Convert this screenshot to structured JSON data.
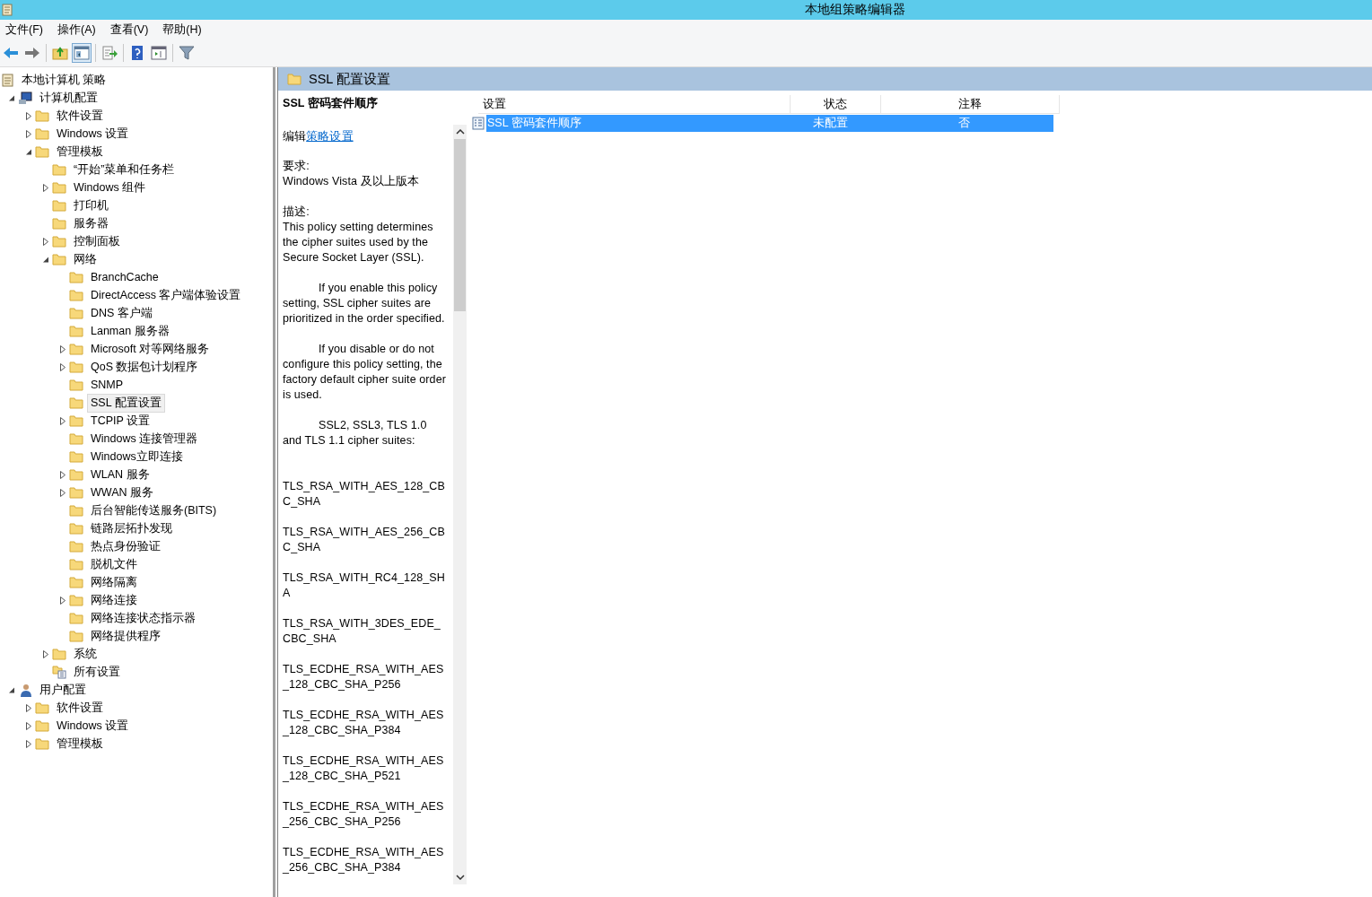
{
  "window": {
    "title": "本地组策略编辑器"
  },
  "menu": [
    "文件(F)",
    "操作(A)",
    "查看(V)",
    "帮助(H)"
  ],
  "toolbar": [
    {
      "kind": "back",
      "pressed": false
    },
    {
      "kind": "forward",
      "pressed": false
    },
    {
      "kind": "up",
      "pressed": false
    },
    {
      "kind": "tree",
      "pressed": true
    },
    {
      "kind": "export",
      "pressed": false
    },
    {
      "kind": "help",
      "pressed": false
    },
    {
      "kind": "view",
      "pressed": false
    },
    {
      "kind": "filter",
      "pressed": false
    }
  ],
  "tree": {
    "root": "本地计算机 策略",
    "items": [
      {
        "label": "计算机配置",
        "kind": "computer",
        "expandable": true,
        "expanded": true,
        "selected": false,
        "children": [
          {
            "label": "软件设置",
            "kind": "folder",
            "expandable": true,
            "expanded": false,
            "selected": false
          },
          {
            "label": "Windows 设置",
            "kind": "folder",
            "expandable": true,
            "expanded": false,
            "selected": false
          },
          {
            "label": "管理模板",
            "kind": "folder",
            "expandable": true,
            "expanded": true,
            "selected": false,
            "children": [
              {
                "label": "“开始”菜单和任务栏",
                "kind": "folder",
                "expandable": false,
                "selected": false
              },
              {
                "label": "Windows 组件",
                "kind": "folder",
                "expandable": true,
                "expanded": false,
                "selected": false
              },
              {
                "label": "打印机",
                "kind": "folder",
                "expandable": false,
                "selected": false
              },
              {
                "label": "服务器",
                "kind": "folder",
                "expandable": false,
                "selected": false
              },
              {
                "label": "控制面板",
                "kind": "folder",
                "expandable": true,
                "expanded": false,
                "selected": false
              },
              {
                "label": "网络",
                "kind": "folder",
                "expandable": true,
                "expanded": true,
                "selected": false,
                "children": [
                  {
                    "label": "BranchCache",
                    "kind": "folder",
                    "expandable": false,
                    "selected": false
                  },
                  {
                    "label": "DirectAccess 客户端体验设置",
                    "kind": "folder",
                    "expandable": false,
                    "selected": false
                  },
                  {
                    "label": "DNS 客户端",
                    "kind": "folder",
                    "expandable": false,
                    "selected": false
                  },
                  {
                    "label": "Lanman 服务器",
                    "kind": "folder",
                    "expandable": false,
                    "selected": false
                  },
                  {
                    "label": "Microsoft 对等网络服务",
                    "kind": "folder",
                    "expandable": true,
                    "expanded": false,
                    "selected": false
                  },
                  {
                    "label": "QoS 数据包计划程序",
                    "kind": "folder",
                    "expandable": true,
                    "expanded": false,
                    "selected": false
                  },
                  {
                    "label": "SNMP",
                    "kind": "folder",
                    "expandable": false,
                    "selected": false
                  },
                  {
                    "label": "SSL 配置设置",
                    "kind": "folder",
                    "expandable": false,
                    "selected": true
                  },
                  {
                    "label": "TCPIP 设置",
                    "kind": "folder",
                    "expandable": true,
                    "expanded": false,
                    "selected": false
                  },
                  {
                    "label": "Windows 连接管理器",
                    "kind": "folder",
                    "expandable": false,
                    "selected": false
                  },
                  {
                    "label": "Windows立即连接",
                    "kind": "folder",
                    "expandable": false,
                    "selected": false
                  },
                  {
                    "label": "WLAN 服务",
                    "kind": "folder",
                    "expandable": true,
                    "expanded": false,
                    "selected": false
                  },
                  {
                    "label": "WWAN 服务",
                    "kind": "folder",
                    "expandable": true,
                    "expanded": false,
                    "selected": false
                  },
                  {
                    "label": "后台智能传送服务(BITS)",
                    "kind": "folder",
                    "expandable": false,
                    "selected": false
                  },
                  {
                    "label": "链路层拓扑发现",
                    "kind": "folder",
                    "expandable": false,
                    "selected": false
                  },
                  {
                    "label": "热点身份验证",
                    "kind": "folder",
                    "expandable": false,
                    "selected": false
                  },
                  {
                    "label": "脱机文件",
                    "kind": "folder",
                    "expandable": false,
                    "selected": false
                  },
                  {
                    "label": "网络隔离",
                    "kind": "folder",
                    "expandable": false,
                    "selected": false
                  },
                  {
                    "label": "网络连接",
                    "kind": "folder",
                    "expandable": true,
                    "expanded": false,
                    "selected": false
                  },
                  {
                    "label": "网络连接状态指示器",
                    "kind": "folder",
                    "expandable": false,
                    "selected": false
                  },
                  {
                    "label": "网络提供程序",
                    "kind": "folder",
                    "expandable": false,
                    "selected": false
                  }
                ]
              },
              {
                "label": "系统",
                "kind": "folder",
                "expandable": true,
                "expanded": false,
                "selected": false
              },
              {
                "label": "所有设置",
                "kind": "all-settings",
                "expandable": false,
                "selected": false
              }
            ]
          }
        ]
      },
      {
        "label": "用户配置",
        "kind": "user",
        "expandable": true,
        "expanded": true,
        "selected": false,
        "children": [
          {
            "label": "软件设置",
            "kind": "folder",
            "expandable": true,
            "expanded": false,
            "selected": false
          },
          {
            "label": "Windows 设置",
            "kind": "folder",
            "expandable": true,
            "expanded": false,
            "selected": false
          },
          {
            "label": "管理模板",
            "kind": "folder",
            "expandable": true,
            "expanded": false,
            "selected": false
          }
        ]
      }
    ]
  },
  "pane": {
    "title": "SSL 配置设置"
  },
  "description": {
    "title": "SSL 密码套件顺序",
    "edit_prefix": "编辑",
    "edit_link": "策略设置",
    "blocks": [
      {
        "kind": "label",
        "text": "要求:"
      },
      {
        "kind": "text",
        "text": "Windows Vista 及以上版本"
      },
      {
        "kind": "gap"
      },
      {
        "kind": "label",
        "text": "描述:"
      },
      {
        "kind": "text",
        "text": "This policy setting determines the cipher suites used by the Secure Socket Layer (SSL)."
      },
      {
        "kind": "gap"
      },
      {
        "kind": "indent",
        "text": "If you enable this policy setting, SSL cipher suites are prioritized in the order specified."
      },
      {
        "kind": "gap"
      },
      {
        "kind": "indent",
        "text": "If you disable or do not configure this policy setting, the factory default cipher suite order is used."
      },
      {
        "kind": "gap"
      },
      {
        "kind": "indent",
        "text": "SSL2, SSL3, TLS 1.0 and TLS 1.1 cipher suites:"
      },
      {
        "kind": "gap"
      },
      {
        "kind": "gap"
      },
      {
        "kind": "cipher",
        "text": "TLS_RSA_WITH_AES_128_CBC_SHA"
      },
      {
        "kind": "cipher",
        "text": "TLS_RSA_WITH_AES_256_CBC_SHA"
      },
      {
        "kind": "cipher",
        "text": "TLS_RSA_WITH_RC4_128_SHA"
      },
      {
        "kind": "cipher",
        "text": "TLS_RSA_WITH_3DES_EDE_CBC_SHA"
      },
      {
        "kind": "cipher",
        "text": "TLS_ECDHE_RSA_WITH_AES_128_CBC_SHA_P256"
      },
      {
        "kind": "cipher",
        "text": "TLS_ECDHE_RSA_WITH_AES_128_CBC_SHA_P384"
      },
      {
        "kind": "cipher",
        "text": "TLS_ECDHE_RSA_WITH_AES_128_CBC_SHA_P521"
      },
      {
        "kind": "cipher",
        "text": "TLS_ECDHE_RSA_WITH_AES_256_CBC_SHA_P256"
      },
      {
        "kind": "cipher",
        "text": "TLS_ECDHE_RSA_WITH_AES_256_CBC_SHA_P384"
      }
    ]
  },
  "table": {
    "columns": [
      "设置",
      "状态",
      "注释"
    ],
    "rows": [
      {
        "cells": [
          "SSL 密码套件顺序",
          "未配置",
          "否"
        ],
        "selected": true
      }
    ]
  }
}
